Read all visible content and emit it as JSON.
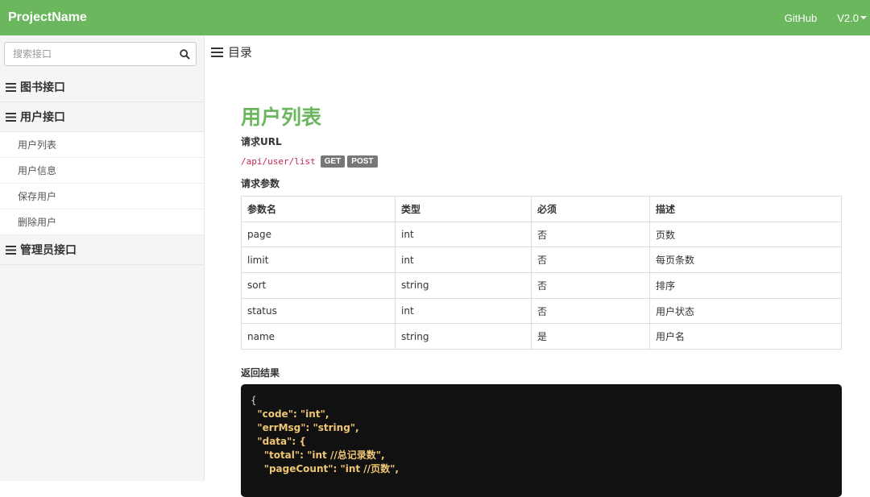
{
  "navbar": {
    "brand": "ProjectName",
    "github": "GitHub",
    "version": "V2.0"
  },
  "sidebar": {
    "search_placeholder": "搜索接口",
    "groups": [
      {
        "label": "图书接口"
      },
      {
        "label": "用户接口",
        "items": [
          "用户列表",
          "用户信息",
          "保存用户",
          "删除用户"
        ]
      },
      {
        "label": "管理员接口"
      }
    ]
  },
  "content": {
    "toc_label": "目录",
    "title": "用户列表",
    "request_url_label": "请求URL",
    "url": "/api/user/list",
    "methods": [
      "GET",
      "POST"
    ],
    "params_label": "请求参数",
    "table": {
      "headers": [
        "参数名",
        "类型",
        "必须",
        "描述"
      ],
      "rows": [
        [
          "page",
          "int",
          "否",
          "页数"
        ],
        [
          "limit",
          "int",
          "否",
          "每页条数"
        ],
        [
          "sort",
          "string",
          "否",
          "排序"
        ],
        [
          "status",
          "int",
          "否",
          "用户状态"
        ],
        [
          "name",
          "string",
          "是",
          "用户名"
        ]
      ]
    },
    "result_label": "返回结果",
    "code_lines": [
      "{",
      "  \"code\": \"int\",",
      "  \"errMsg\": \"string\",",
      "  \"data\": {",
      "    \"total\": \"int //总记录数\",",
      "    \"pageCount\": \"int //页数\","
    ]
  }
}
